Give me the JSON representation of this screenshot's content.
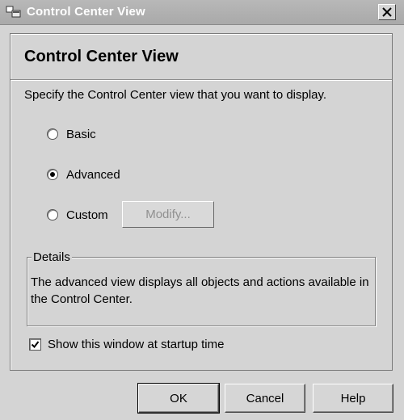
{
  "window": {
    "title": "Control Center View",
    "icons": {
      "app": "app-window-icon",
      "close": "close-icon"
    }
  },
  "main": {
    "heading": "Control Center View",
    "instruction": "Specify the Control Center view that you want to display.",
    "view_options": [
      {
        "label": "Basic",
        "selected": false
      },
      {
        "label": "Advanced",
        "selected": true
      },
      {
        "label": "Custom",
        "selected": false
      }
    ],
    "modify_button": {
      "label": "Modify...",
      "enabled": false
    },
    "details": {
      "legend": "Details",
      "text": "The advanced view displays all objects and actions available in the Control Center."
    },
    "startup_checkbox": {
      "label": "Show this window at startup time",
      "checked": true
    }
  },
  "footer": {
    "ok_label": "OK",
    "cancel_label": "Cancel",
    "help_label": "Help"
  }
}
